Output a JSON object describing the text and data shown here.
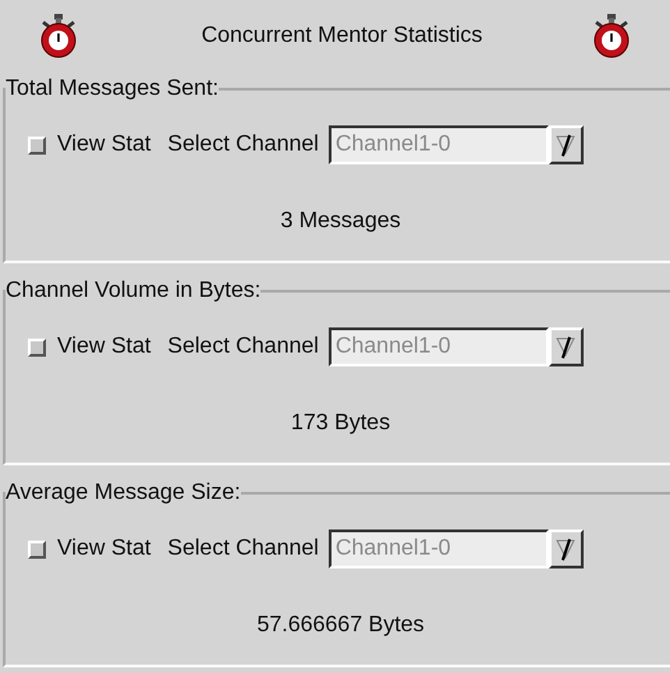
{
  "window": {
    "title": "Concurrent Mentor Statistics"
  },
  "panels": [
    {
      "legend": "Total Messages Sent:",
      "view_stat": {
        "label": "View Stat",
        "checked": false
      },
      "select_label": "Select Channel",
      "channel": "Channel1-0",
      "value": "3 Messages"
    },
    {
      "legend": "Channel Volume in Bytes:",
      "view_stat": {
        "label": "View Stat",
        "checked": false
      },
      "select_label": "Select Channel",
      "channel": "Channel1-0",
      "value": "173 Bytes"
    },
    {
      "legend": "Average Message Size:",
      "view_stat": {
        "label": "View Stat",
        "checked": false
      },
      "select_label": "Select Channel",
      "channel": "Channel1-0",
      "value": "57.666667 Bytes"
    }
  ]
}
